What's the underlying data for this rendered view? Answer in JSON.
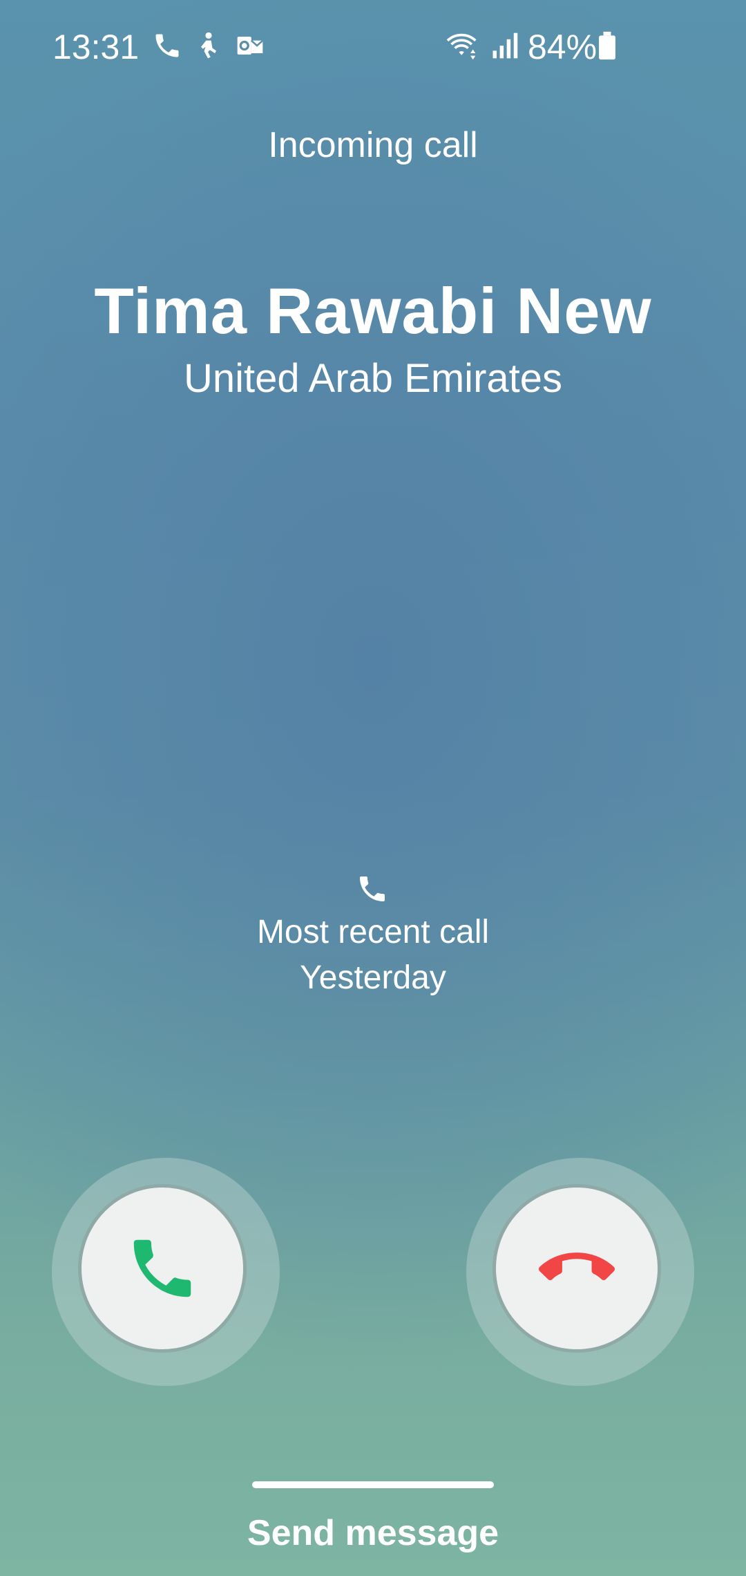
{
  "status_bar": {
    "time": "13:31",
    "notification_icons": [
      "phone-icon",
      "accessibility-icon",
      "outlook-icon"
    ],
    "system_icons": [
      "wifi-icon",
      "signal-icon",
      "battery-icon"
    ],
    "battery_percent": "84%"
  },
  "call": {
    "header": "Incoming call",
    "caller_name": "Tima Rawabi New",
    "caller_location": "United Arab Emirates",
    "recent_label": "Most recent call",
    "recent_time": "Yesterday"
  },
  "actions": {
    "accept_icon": "phone-accept-icon",
    "decline_icon": "phone-decline-icon",
    "send_message": "Send message"
  },
  "colors": {
    "accept": "#1fb870",
    "decline": "#f24646",
    "button_bg": "#eff1f1"
  }
}
